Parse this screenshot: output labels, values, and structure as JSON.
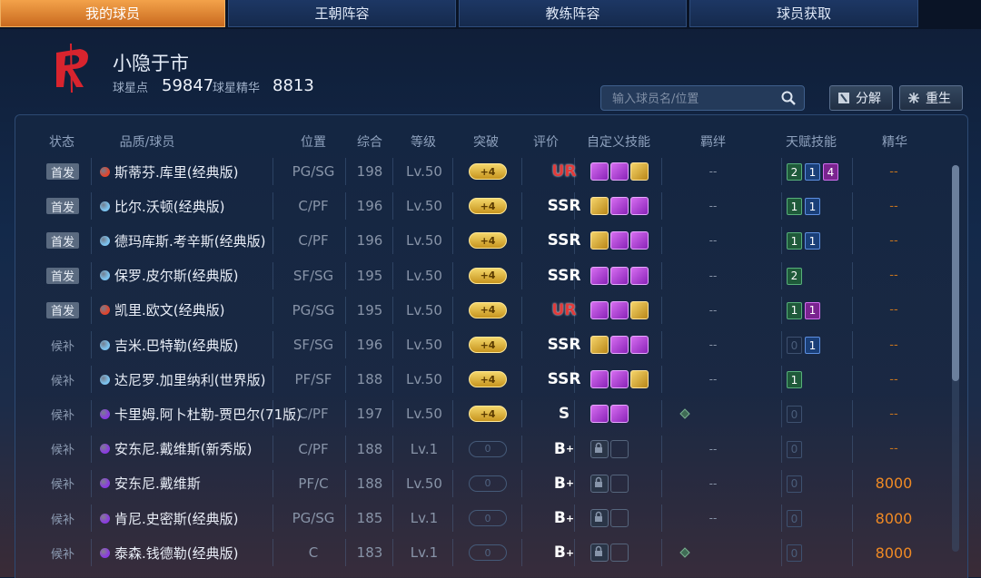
{
  "tabs": [
    "我的球员",
    "王朝阵容",
    "教练阵容",
    "球员获取"
  ],
  "header": {
    "team_name": "小隐于市",
    "points_label": "球星点",
    "points_value": "59847",
    "essence_label": "球星精华",
    "essence_value": "8813"
  },
  "search": {
    "placeholder": "输入球员名/位置"
  },
  "buttons": {
    "decompose": "分解",
    "rebirth": "重生"
  },
  "columns": [
    "状态",
    "品质/球员",
    "位置",
    "综合",
    "等级",
    "突破",
    "评价",
    "自定义技能",
    "羁绊",
    "天赋技能",
    "精华"
  ],
  "colors": {
    "accent_tab": "#e6892f",
    "ur": "#e23a3a",
    "essence": "#f08a24"
  },
  "rows": [
    {
      "status": "首发",
      "quality": "red",
      "name": "斯蒂芬.库里(经典版)",
      "pos": "PG/SG",
      "ovr": "198",
      "level": "Lv.50",
      "breakthrough": "+4",
      "grade": "UR",
      "skills": [
        "p",
        "p",
        "g"
      ],
      "bond": "--",
      "talents": [
        [
          "2",
          "g"
        ],
        [
          "1",
          "b"
        ],
        [
          "4",
          "p"
        ]
      ],
      "essence": "--"
    },
    {
      "status": "首发",
      "quality": "blue",
      "name": "比尔.沃顿(经典版)",
      "pos": "C/PF",
      "ovr": "196",
      "level": "Lv.50",
      "breakthrough": "+4",
      "grade": "SSR",
      "skills": [
        "g",
        "p",
        "p"
      ],
      "bond": "--",
      "talents": [
        [
          "1",
          "g"
        ],
        [
          "1",
          "b"
        ]
      ],
      "essence": "--"
    },
    {
      "status": "首发",
      "quality": "blue",
      "name": "德玛库斯.考辛斯(经典版)",
      "pos": "C/PF",
      "ovr": "196",
      "level": "Lv.50",
      "breakthrough": "+4",
      "grade": "SSR",
      "skills": [
        "g",
        "p",
        "p"
      ],
      "bond": "--",
      "talents": [
        [
          "1",
          "g"
        ],
        [
          "1",
          "b"
        ]
      ],
      "essence": "--"
    },
    {
      "status": "首发",
      "quality": "blue",
      "name": "保罗.皮尔斯(经典版)",
      "pos": "SF/SG",
      "ovr": "195",
      "level": "Lv.50",
      "breakthrough": "+4",
      "grade": "SSR",
      "skills": [
        "p",
        "p",
        "p"
      ],
      "bond": "--",
      "talents": [
        [
          "2",
          "g"
        ]
      ],
      "essence": "--"
    },
    {
      "status": "首发",
      "quality": "red",
      "name": "凯里.欧文(经典版)",
      "pos": "PG/SG",
      "ovr": "195",
      "level": "Lv.50",
      "breakthrough": "+4",
      "grade": "UR",
      "skills": [
        "p",
        "p",
        "g"
      ],
      "bond": "--",
      "talents": [
        [
          "1",
          "g"
        ],
        [
          "1",
          "p"
        ]
      ],
      "essence": "--"
    },
    {
      "status": "候补",
      "quality": "blue",
      "name": "吉米.巴特勒(经典版)",
      "pos": "SF/SG",
      "ovr": "196",
      "level": "Lv.50",
      "breakthrough": "+4",
      "grade": "SSR",
      "skills": [
        "g",
        "p",
        "p"
      ],
      "bond": "--",
      "talents": [
        [
          "0",
          "0"
        ],
        [
          "1",
          "b"
        ]
      ],
      "essence": "--"
    },
    {
      "status": "候补",
      "quality": "blue",
      "name": "达尼罗.加里纳利(世界版)",
      "pos": "PF/SF",
      "ovr": "188",
      "level": "Lv.50",
      "breakthrough": "+4",
      "grade": "SSR",
      "skills": [
        "p",
        "p",
        "g"
      ],
      "bond": "--",
      "talents": [
        [
          "1",
          "g"
        ]
      ],
      "essence": "--"
    },
    {
      "status": "候补",
      "quality": "purple",
      "name": "卡里姆.阿卜杜勒-贾巴尔(71版)",
      "pos": "C/PF",
      "ovr": "197",
      "level": "Lv.50",
      "breakthrough": "+4",
      "grade": "S",
      "skills": [
        "p",
        "p"
      ],
      "bond": "icon",
      "talents": [
        [
          "0",
          "0"
        ]
      ],
      "essence": "--"
    },
    {
      "status": "候补",
      "quality": "purple",
      "name": "安东尼.戴维斯(新秀版)",
      "pos": "C/PF",
      "ovr": "188",
      "level": "Lv.1",
      "breakthrough": "0",
      "grade": "B+",
      "skills": [
        "lock",
        "empty"
      ],
      "bond": "--",
      "talents": [
        [
          "0",
          "0"
        ]
      ],
      "essence": "--"
    },
    {
      "status": "候补",
      "quality": "purple",
      "name": "安东尼.戴维斯",
      "pos": "PF/C",
      "ovr": "188",
      "level": "Lv.50",
      "breakthrough": "0",
      "grade": "B+",
      "skills": [
        "lock",
        "empty"
      ],
      "bond": "--",
      "talents": [
        [
          "0",
          "0"
        ]
      ],
      "essence": "8000"
    },
    {
      "status": "候补",
      "quality": "purple",
      "name": "肯尼.史密斯(经典版)",
      "pos": "PG/SG",
      "ovr": "185",
      "level": "Lv.1",
      "breakthrough": "0",
      "grade": "B+",
      "skills": [
        "lock",
        "empty"
      ],
      "bond": "--",
      "talents": [
        [
          "0",
          "0"
        ]
      ],
      "essence": "8000"
    },
    {
      "status": "候补",
      "quality": "purple",
      "name": "泰森.钱德勒(经典版)",
      "pos": "C",
      "ovr": "183",
      "level": "Lv.1",
      "breakthrough": "0",
      "grade": "B+",
      "skills": [
        "lock",
        "empty"
      ],
      "bond": "icon",
      "talents": [
        [
          "0",
          "0"
        ]
      ],
      "essence": "8000"
    }
  ]
}
